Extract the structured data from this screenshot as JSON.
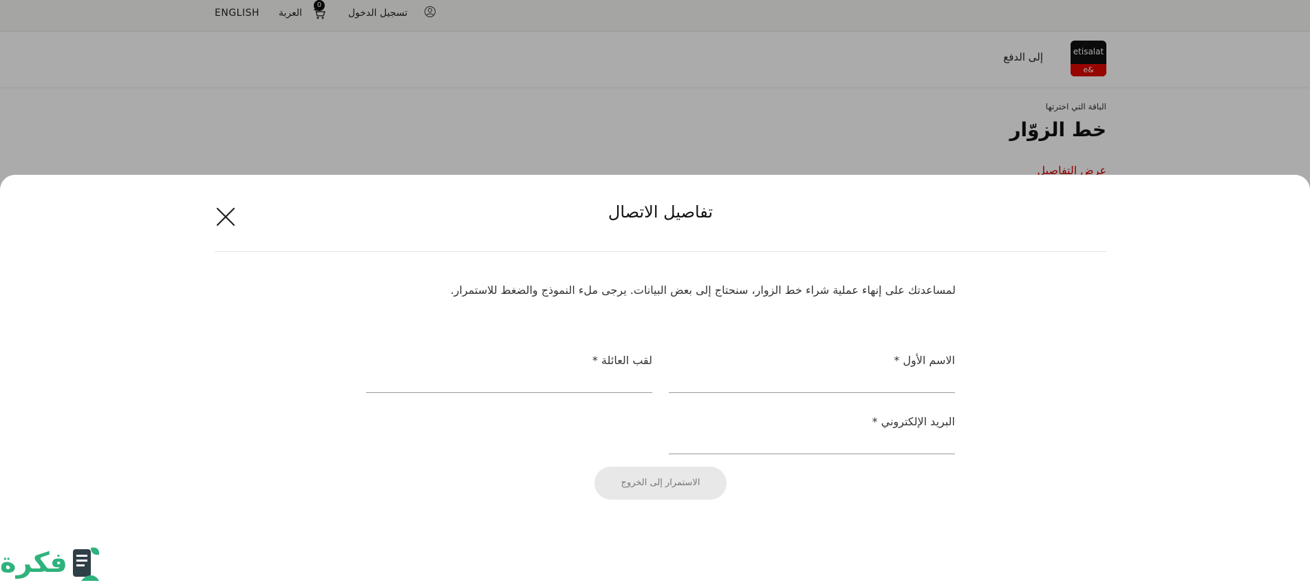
{
  "topbar": {
    "lang_en": "ENGLISH",
    "lang_ar": "العربة",
    "cart_count": "0",
    "login": "تسجيل الدخول"
  },
  "header": {
    "logo_text": "etisalat",
    "logo_sub": "e&",
    "checkout_title": "إلى الدفع"
  },
  "plan": {
    "label": "الباقة التي اخترتها",
    "name": "خط الزوّار",
    "details_link": "عرض التفاصيل"
  },
  "modal": {
    "title": "تفاصيل الاتصال",
    "intro": "لمساعدتك على إنهاء عملية شراء خط الزوار، سنحتاج إلى بعض البيانات. يرجى ملء النموذج والضغط للاستمرار.",
    "first_name_label": "الاسم الأول *",
    "last_name_label": "لقب العائلة *",
    "email_label": "البريد الإلكتروني *",
    "continue_button": "الاستمرار إلى الخروج"
  },
  "watermark": {
    "text": "فكرة"
  },
  "colors": {
    "brand_red": "#e00800",
    "link_red": "#d10000",
    "watermark_green": "#2fb27d"
  }
}
